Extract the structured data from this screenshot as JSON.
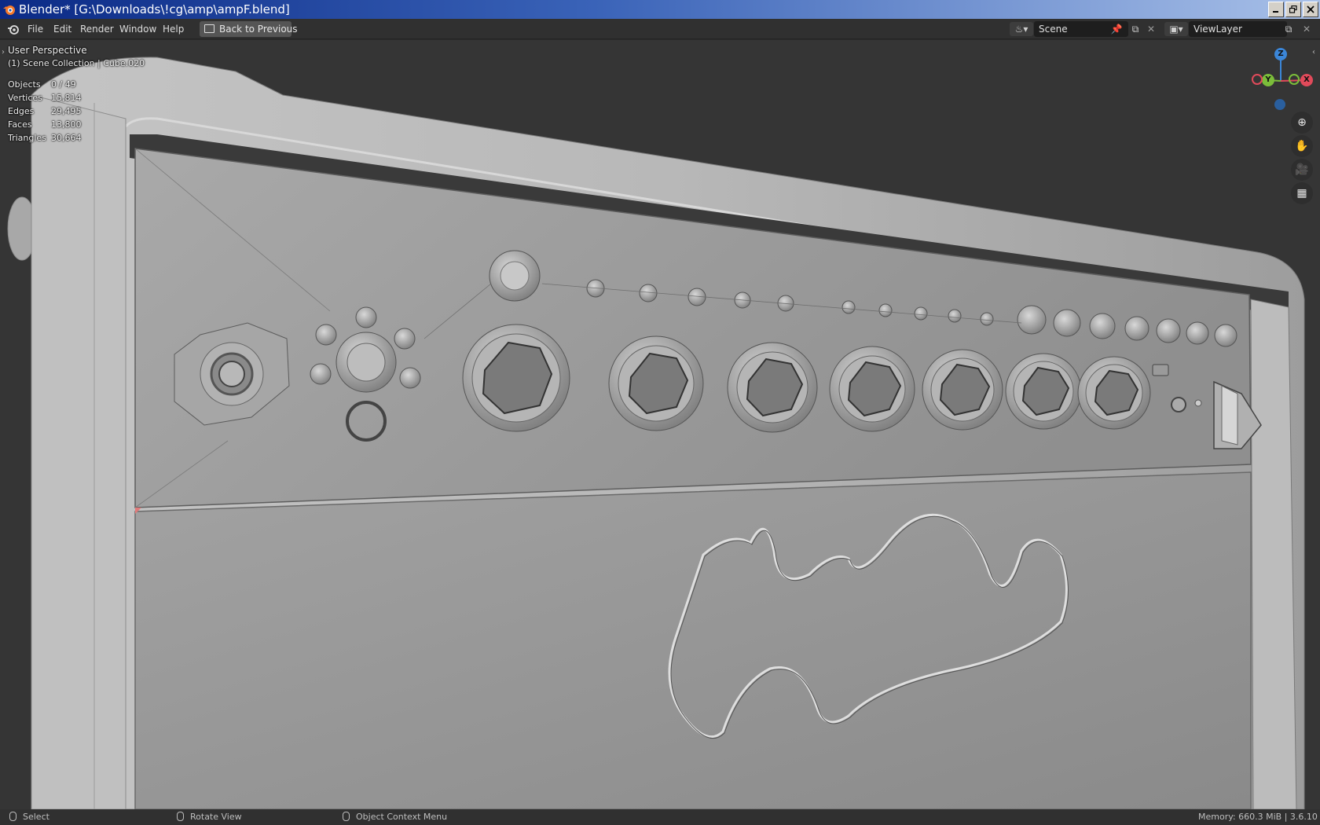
{
  "window": {
    "title": "Blender* [G:\\Downloads\\!cg\\amp\\ampF.blend]",
    "controls": [
      "minimize-icon",
      "restore-icon",
      "close-icon"
    ]
  },
  "menu": {
    "items": [
      "File",
      "Edit",
      "Render",
      "Window",
      "Help"
    ],
    "back_button": "Back to Previous"
  },
  "scene": {
    "label": "Scene"
  },
  "view_layer": {
    "label": "ViewLayer"
  },
  "viewport": {
    "perspective": "User Perspective",
    "collection": "(1) Scene Collection | Cube.020",
    "stats": [
      {
        "label": "Objects",
        "value": "0 / 49"
      },
      {
        "label": "Vertices",
        "value": "15,814"
      },
      {
        "label": "Edges",
        "value": "29,495"
      },
      {
        "label": "Faces",
        "value": "13,800"
      },
      {
        "label": "Triangles",
        "value": "30,664"
      }
    ],
    "gizmo": {
      "z": "Z",
      "y": "Y",
      "x": "X"
    },
    "nav_icons": [
      "zoom-icon",
      "hand-pan-icon",
      "camera-icon",
      "grid-ortho-icon"
    ]
  },
  "statusbar": {
    "select": "Select",
    "rotate": "Rotate View",
    "context": "Object Context Menu",
    "memory": "Memory: 660.3 MiB | 3.6.10"
  },
  "colors": {
    "viewport_bg": "#353535",
    "header_bg": "#303030",
    "gizmo_x": "#e04a5a",
    "gizmo_y": "#7bbd3a",
    "gizmo_z": "#3b86d8"
  }
}
